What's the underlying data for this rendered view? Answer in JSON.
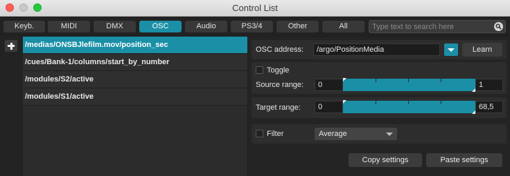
{
  "window": {
    "title": "Control List"
  },
  "tabs": [
    {
      "label": "Keyb.",
      "active": false
    },
    {
      "label": "MIDI",
      "active": false
    },
    {
      "label": "DMX",
      "active": false
    },
    {
      "label": "OSC",
      "active": true
    },
    {
      "label": "Audio",
      "active": false
    },
    {
      "label": "PS3/4",
      "active": false
    },
    {
      "label": "Other",
      "active": false
    },
    {
      "label": "All",
      "active": false
    }
  ],
  "search": {
    "placeholder": "Type text to search here",
    "icon": "search-icon"
  },
  "list": {
    "add_icon": "plus-icon",
    "items": [
      {
        "label": "/medias/ONSBJlefilm.mov/position_sec",
        "selected": true
      },
      {
        "label": "/cues/Bank-1/columns/start_by_number",
        "selected": false
      },
      {
        "label": "/modules/S2/active",
        "selected": false
      },
      {
        "label": "/modules/S1/active",
        "selected": false
      }
    ]
  },
  "settings": {
    "osc_address_label": "OSC address:",
    "osc_address_value": "/argo/PositionMedia",
    "learn_label": "Learn",
    "toggle_label": "Toggle",
    "toggle_checked": false,
    "source_range_label": "Source range:",
    "source_min": "0",
    "source_max": "1",
    "target_range_label": "Target range:",
    "target_min": "0",
    "target_max": "68,5",
    "filter_label": "Filter",
    "filter_checked": false,
    "filter_mode": "Average",
    "copy_label": "Copy settings",
    "paste_label": "Paste settings"
  },
  "colors": {
    "accent": "#1a8fa6",
    "background": "#1e1e1e",
    "panel": "#2d2d2d"
  }
}
